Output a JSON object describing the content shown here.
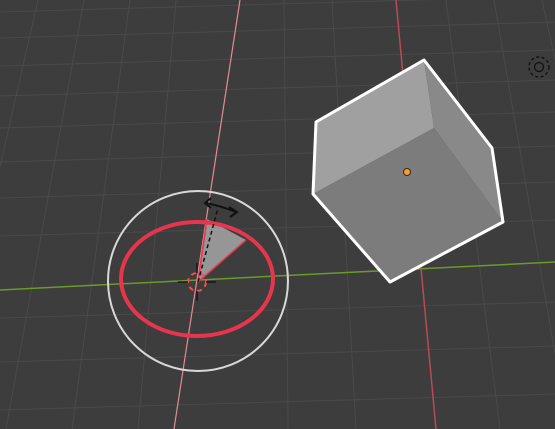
{
  "viewport": {
    "background_color": "#3d3d3d",
    "grid_color": "#4a4a4a",
    "x_axis_color": "#b84a58",
    "y_axis_color": "#6a9a2a",
    "z_axis_color": "#e28b98"
  },
  "object": {
    "type": "cube",
    "selected": true,
    "outline_color": "#ffffff",
    "origin_color": "#f0a030"
  },
  "gizmo": {
    "tool": "rotate",
    "axis": "z",
    "trackball_color": "#d8d8d8",
    "active_ring_color": "#e8354f",
    "sector_color": "#b4b4b4",
    "icon": "rotate-drag-arrows-icon"
  },
  "light": {
    "icon": "light-icon"
  }
}
